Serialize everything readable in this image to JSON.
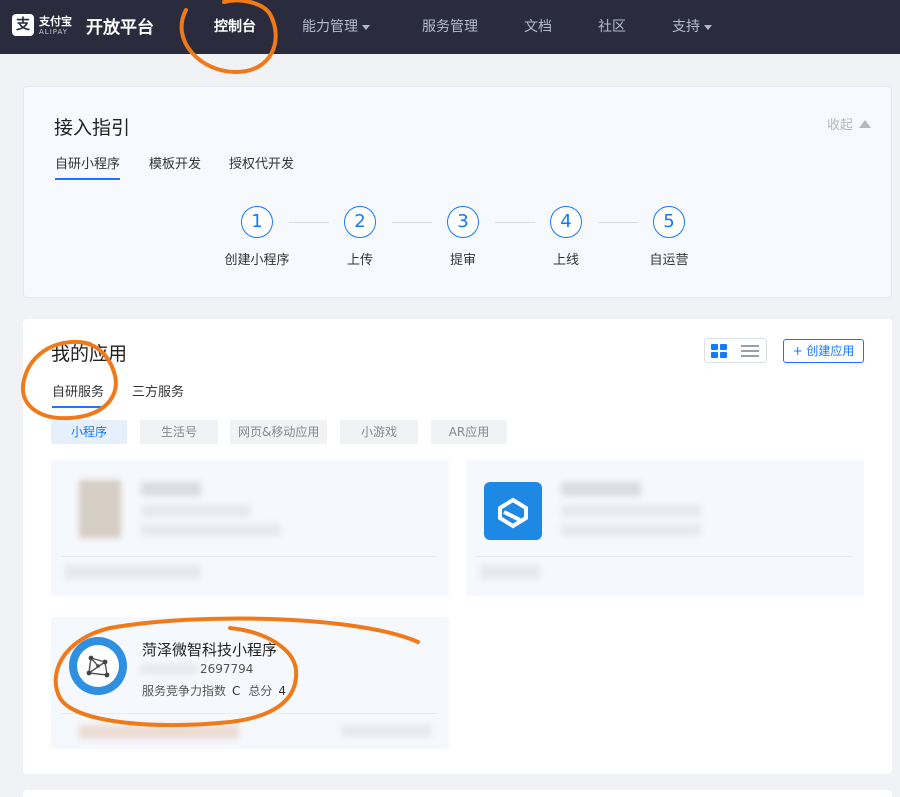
{
  "header": {
    "logo_cn": "支付宝",
    "logo_en": "ALIPAY",
    "brand": "开放平台",
    "nav": [
      {
        "label": "控制台",
        "active": true
      },
      {
        "label": "能力管理",
        "dropdown": true
      },
      {
        "label": "服务管理"
      },
      {
        "label": "文档"
      },
      {
        "label": "社区"
      },
      {
        "label": "支持",
        "dropdown": true
      }
    ]
  },
  "guide": {
    "title": "接入指引",
    "collapse_label": "收起",
    "tabs": [
      {
        "label": "自研小程序",
        "active": true
      },
      {
        "label": "模板开发"
      },
      {
        "label": "授权代开发"
      }
    ],
    "steps": [
      {
        "num": "1",
        "label": "创建小程序"
      },
      {
        "num": "2",
        "label": "上传"
      },
      {
        "num": "3",
        "label": "提审"
      },
      {
        "num": "4",
        "label": "上线"
      },
      {
        "num": "5",
        "label": "自运营"
      }
    ]
  },
  "apps": {
    "title": "我的应用",
    "create_label": "+ 创建应用",
    "tabs": [
      {
        "label": "自研服务",
        "active": true
      },
      {
        "label": "三方服务"
      }
    ],
    "filters": [
      {
        "label": "小程序",
        "active": true
      },
      {
        "label": "生活号"
      },
      {
        "label": "网页&移动应用"
      },
      {
        "label": "小游戏"
      },
      {
        "label": "AR应用"
      }
    ],
    "visible_app": {
      "name": "菏泽微智科技小程序",
      "id_suffix": "2697794",
      "score_label": "服务竞争力指数",
      "score_grade": "C",
      "total_label": "总分",
      "total_value": "4"
    }
  },
  "colors": {
    "nav_bg": "#2a2c3e",
    "accent": "#1677ff",
    "annotation": "#f07a1a"
  },
  "icons": [
    "alipay-logo-icon",
    "grid-view-icon",
    "list-view-icon",
    "app-icon",
    "network-icon",
    "collapse-arrow-icon",
    "dropdown-caret-icon"
  ]
}
